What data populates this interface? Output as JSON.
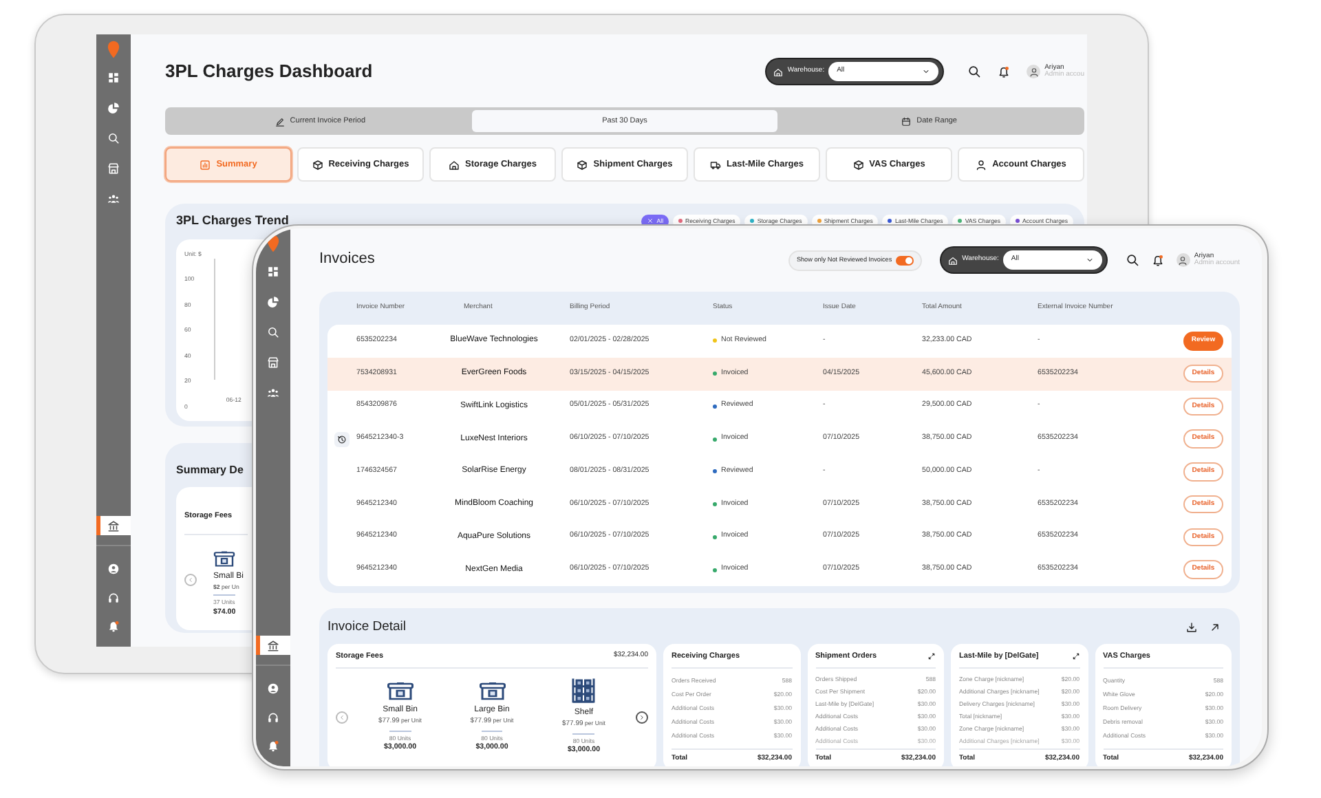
{
  "back_screen": {
    "sidebar": {
      "items": [
        {
          "selected": false
        },
        {
          "selected": false
        },
        {
          "selected": false
        },
        {
          "selected": false
        },
        {
          "selected": false
        }
      ],
      "footer_items": [
        {
          "selected": true
        },
        {
          "selected": false
        },
        {
          "selected": false
        },
        {
          "selected": false
        }
      ]
    },
    "title": "3PL Charges Dashboard",
    "warehouse": {
      "label": "Warehouse:",
      "value": "All"
    },
    "user": {
      "name": "Ariyan",
      "role": "Admin accou"
    },
    "period_tabs": [
      {
        "label": "Current Invoice Period",
        "selected": false
      },
      {
        "label": "Past 30 Days",
        "selected": true
      },
      {
        "label": "Date Range",
        "selected": false
      }
    ],
    "charge_tabs": [
      {
        "label": "Summary",
        "selected": true
      },
      {
        "label": "Receiving Charges",
        "selected": false
      },
      {
        "label": "Storage Charges",
        "selected": false
      },
      {
        "label": "Shipment Charges",
        "selected": false
      },
      {
        "label": "Last-Mile Charges",
        "selected": false
      },
      {
        "label": "VAS Charges",
        "selected": false
      },
      {
        "label": "Account Charges",
        "selected": false
      }
    ],
    "trend": {
      "title": "3PL Charges Trend",
      "filters": [
        {
          "label": "All",
          "selected": true,
          "color": "#7b6cf6"
        },
        {
          "label": "Receiving Charges",
          "selected": false,
          "color": "#e66b7f"
        },
        {
          "label": "Storage Charges",
          "selected": false,
          "color": "#2fb5c9"
        },
        {
          "label": "Shipment Charges",
          "selected": false,
          "color": "#f2a33a"
        },
        {
          "label": "Last-Mile Charges",
          "selected": false,
          "color": "#3a5bd9"
        },
        {
          "label": "VAS Charges",
          "selected": false,
          "color": "#4cb97a"
        },
        {
          "label": "Account Charges",
          "selected": false,
          "color": "#7a4fd6"
        }
      ],
      "unit": "Unit: $",
      "y_tick_labels": [
        "100",
        "80",
        "60",
        "40",
        "20",
        "0"
      ],
      "x_tick_labels": [
        "06-12"
      ]
    },
    "summary": {
      "title": "Summary De",
      "section": "Storage Fees",
      "item": {
        "name": "Small Bi",
        "price": "$2",
        "price_unit": "per Un",
        "units": "37 Units",
        "amount": "$74.00"
      }
    }
  },
  "front_screen": {
    "sidebar": {
      "items": [
        {
          "selected": false
        },
        {
          "selected": false
        },
        {
          "selected": false
        },
        {
          "selected": false
        },
        {
          "selected": false
        }
      ],
      "footer_items": [
        {
          "selected": true
        },
        {
          "selected": false
        },
        {
          "selected": false
        },
        {
          "selected": false
        }
      ]
    },
    "title": "Invoices",
    "filter_toggle": {
      "label": "Show only Not Reviewed Invoices",
      "on": true
    },
    "warehouse": {
      "label": "Warehouse:",
      "value": "All"
    },
    "user": {
      "name": "Ariyan",
      "role": "Admin account"
    },
    "table": {
      "columns": [
        "Invoice Number",
        "Merchant",
        "Billing Period",
        "Status",
        "Issue Date",
        "Total Amount",
        "External Invoice Number"
      ],
      "rows": [
        {
          "invoice_number": "6535202234",
          "merchant": "BlueWave Technologies",
          "billing_period": "02/01/2025 - 02/28/2025",
          "status": "Not Reviewed",
          "color": "#f0c419",
          "issue_date": "-",
          "total_amount": "32,233.00 CAD",
          "external_invoice_number": "-",
          "action": {
            "label": "Review",
            "kind": "primary"
          },
          "selected": false,
          "has_history": false
        },
        {
          "invoice_number": "7534208931",
          "merchant": "EverGreen Foods",
          "billing_period": "03/15/2025 - 04/15/2025",
          "status": "Invoiced",
          "color": "#37a96b",
          "issue_date": "04/15/2025",
          "total_amount": "45,600.00 CAD",
          "external_invoice_number": "6535202234",
          "action": {
            "label": "Details",
            "kind": "outline"
          },
          "selected": true,
          "has_history": false
        },
        {
          "invoice_number": "8543209876",
          "merchant": "SwiftLink Logistics",
          "billing_period": "05/01/2025 - 05/31/2025",
          "status": "Reviewed",
          "color": "#2e6bbf",
          "issue_date": "-",
          "total_amount": "29,500.00 CAD",
          "external_invoice_number": "-",
          "action": {
            "label": "Details",
            "kind": "outline"
          },
          "selected": false,
          "has_history": false
        },
        {
          "invoice_number": "9645212340-3",
          "merchant": "LuxeNest Interiors",
          "billing_period": "06/10/2025 - 07/10/2025",
          "status": "Invoiced",
          "color": "#37a96b",
          "issue_date": "07/10/2025",
          "total_amount": "38,750.00 CAD",
          "external_invoice_number": "6535202234",
          "action": {
            "label": "Details",
            "kind": "outline"
          },
          "selected": false,
          "has_history": true
        },
        {
          "invoice_number": "1746324567",
          "merchant": "SolarRise Energy",
          "billing_period": "08/01/2025 - 08/31/2025",
          "status": "Reviewed",
          "color": "#2e6bbf",
          "issue_date": "-",
          "total_amount": "50,000.00 CAD",
          "external_invoice_number": "-",
          "action": {
            "label": "Details",
            "kind": "outline"
          },
          "selected": false,
          "has_history": false
        },
        {
          "invoice_number": "9645212340",
          "merchant": "MindBloom Coaching",
          "billing_period": "06/10/2025 - 07/10/2025",
          "status": "Invoiced",
          "color": "#37a96b",
          "issue_date": "07/10/2025",
          "total_amount": "38,750.00 CAD",
          "external_invoice_number": "6535202234",
          "action": {
            "label": "Details",
            "kind": "outline"
          },
          "selected": false,
          "has_history": false
        },
        {
          "invoice_number": "9645212340",
          "merchant": "AquaPure Solutions",
          "billing_period": "06/10/2025 - 07/10/2025",
          "status": "Invoiced",
          "color": "#37a96b",
          "issue_date": "07/10/2025",
          "total_amount": "38,750.00 CAD",
          "external_invoice_number": "6535202234",
          "action": {
            "label": "Details",
            "kind": "outline"
          },
          "selected": false,
          "has_history": false
        },
        {
          "invoice_number": "9645212340",
          "merchant": "NextGen Media",
          "billing_period": "06/10/2025 - 07/10/2025",
          "status": "Invoiced",
          "color": "#37a96b",
          "issue_date": "07/10/2025",
          "total_amount": "38,750.00 CAD",
          "external_invoice_number": "6535202234",
          "action": {
            "label": "Details",
            "kind": "outline"
          },
          "selected": false,
          "has_history": false
        }
      ]
    },
    "invoice_detail": {
      "title": "Invoice Detail",
      "storage": {
        "title": "Storage Fees",
        "total": "$32,234.00",
        "items": [
          {
            "name": "Small Bin",
            "price": "$77.99",
            "price_unit": "per Unit",
            "units": "80 Units",
            "amount": "$3,000.00",
            "kind": "bin"
          },
          {
            "name": "Large Bin",
            "price": "$77.99",
            "price_unit": "per Unit",
            "units": "80 Units",
            "amount": "$3,000.00",
            "kind": "bin"
          },
          {
            "name": "Shelf",
            "price": "$77.99",
            "price_unit": "per Unit",
            "units": "80 Units",
            "amount": "$3,000.00",
            "kind": "shelf"
          }
        ]
      },
      "charge_cards": [
        {
          "title": "Receiving Charges",
          "expandable": false,
          "lines": [
            {
              "label": "Orders Received",
              "value": "588",
              "faded": false
            },
            {
              "label": "Cost Per Order",
              "value": "$20.00",
              "faded": false
            },
            {
              "label": "Additional Costs",
              "value": "$30.00",
              "faded": false
            },
            {
              "label": "Additional Costs",
              "value": "$30.00",
              "faded": false
            },
            {
              "label": "Additional Costs",
              "value": "$30.00",
              "faded": false
            }
          ],
          "total_label": "Total",
          "total": "$32,234.00"
        },
        {
          "title": "Shipment Orders",
          "expandable": true,
          "lines": [
            {
              "label": "Orders Shipped",
              "value": "588",
              "faded": false
            },
            {
              "label": "Cost Per Shipment",
              "value": "$20.00",
              "faded": false
            },
            {
              "label": "Last-Mile by [DelGate]",
              "value": "$30.00",
              "faded": false
            },
            {
              "label": "Additional Costs",
              "value": "$30.00",
              "faded": false
            },
            {
              "label": "Additional Costs",
              "value": "$30.00",
              "faded": false
            },
            {
              "label": "Additional Costs",
              "value": "$30.00",
              "faded": true
            }
          ],
          "total_label": "Total",
          "total": "$32,234.00"
        },
        {
          "title": "Last-Mile by [DelGate]",
          "expandable": true,
          "lines": [
            {
              "label": "Zone Charge [nickname]",
              "value": "$20.00",
              "faded": false
            },
            {
              "label": "Additional Charges [nickname]",
              "value": "$20.00",
              "faded": false
            },
            {
              "label": "Delivery Charges [nickname]",
              "value": "$30.00",
              "faded": false
            },
            {
              "label": "Total [nickname]",
              "value": "$30.00",
              "faded": false
            },
            {
              "label": "Zone Charge [nickname]",
              "value": "$30.00",
              "faded": false
            },
            {
              "label": "Additional Charges [nickname]",
              "value": "$30.00",
              "faded": true
            }
          ],
          "total_label": "Total",
          "total": "$32,234.00"
        },
        {
          "title": "VAS Charges",
          "expandable": false,
          "lines": [
            {
              "label": "Quantity",
              "value": "588",
              "faded": false
            },
            {
              "label": "White Glove",
              "value": "$20.00",
              "faded": false
            },
            {
              "label": "Room Delivery",
              "value": "$30.00",
              "faded": false
            },
            {
              "label": "Debris removal",
              "value": "$30.00",
              "faded": false
            },
            {
              "label": "Additional Costs",
              "value": "$30.00",
              "faded": false
            }
          ],
          "total_label": "Total",
          "total": "$32,234.00"
        }
      ]
    }
  }
}
